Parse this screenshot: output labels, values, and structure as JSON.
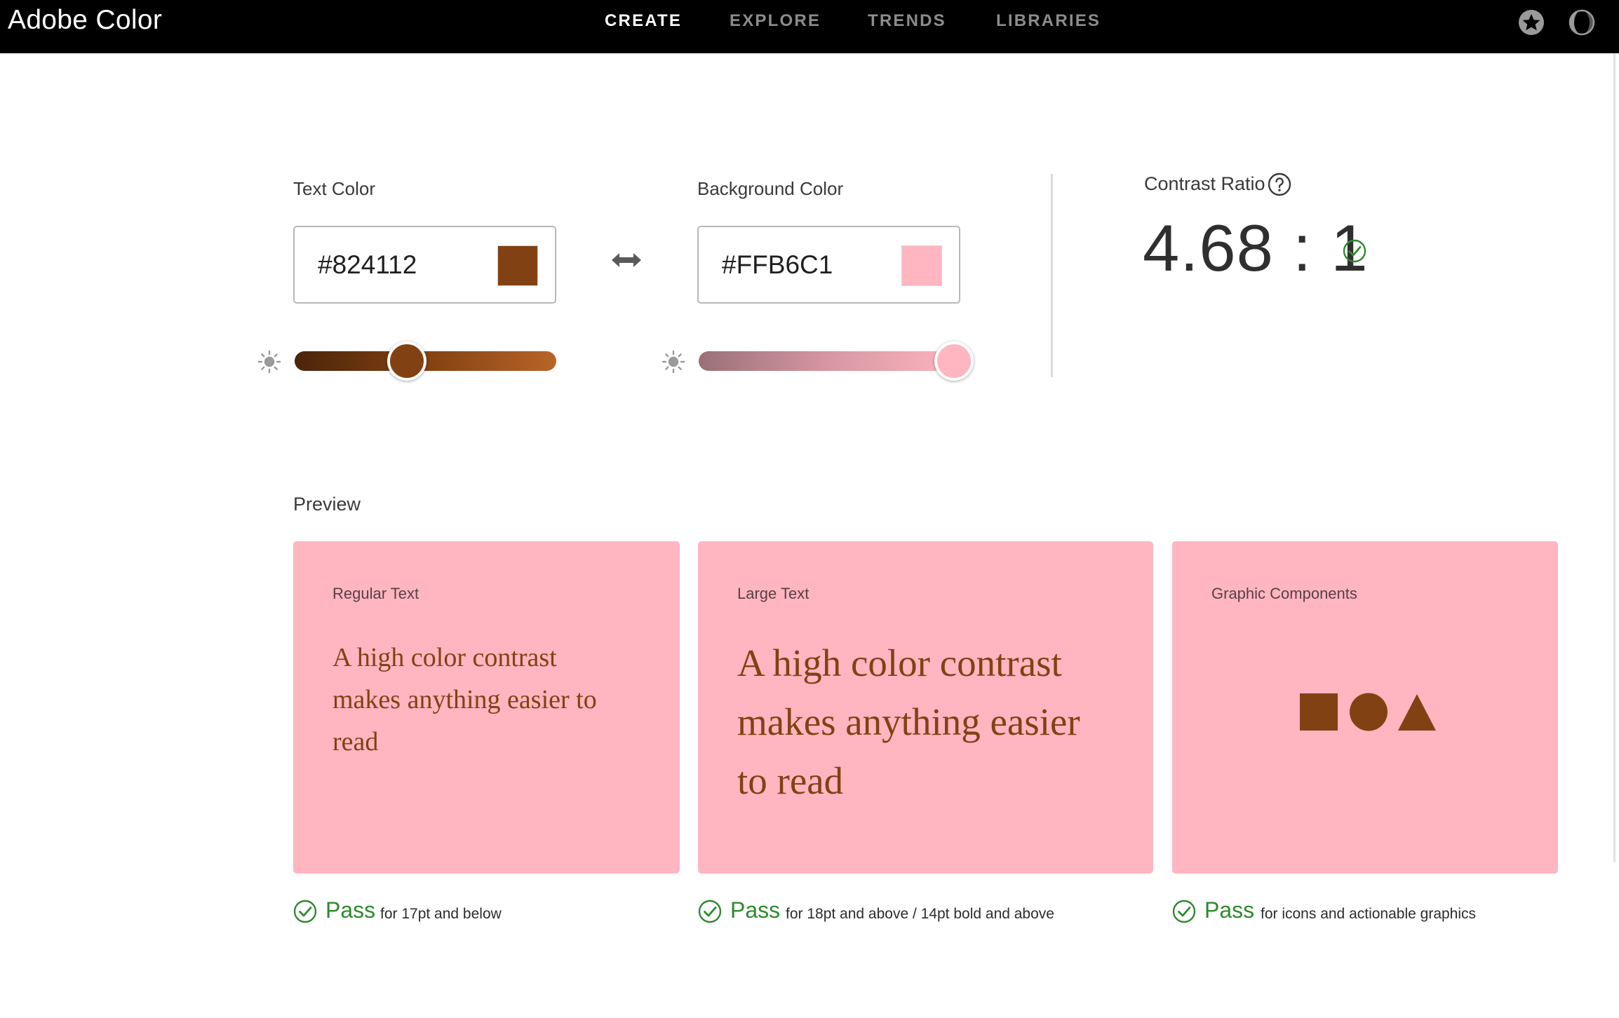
{
  "header": {
    "logo": "Adobe Color",
    "nav": [
      "CREATE",
      "EXPLORE",
      "TRENDS",
      "LIBRARIES"
    ],
    "active_nav": "CREATE",
    "icons": [
      "favorites-icon",
      "theme-toggle-icon"
    ]
  },
  "text_color": {
    "label": "Text Color",
    "hex": "#824112",
    "swatch": "#824112",
    "brightness_level": 0.43
  },
  "background_color": {
    "label": "Background Color",
    "hex": "#FFB6C1",
    "swatch": "#FFB6C1",
    "brightness_level": 1.0
  },
  "contrast": {
    "label": "Contrast Ratio",
    "value": "4.68 : 1",
    "status": "pass"
  },
  "preview": {
    "label": "Preview",
    "cards": [
      {
        "title": "Regular Text",
        "sample": "A high color contrast makes anything easier to read"
      },
      {
        "title": "Large Text",
        "sample": "A high color contrast makes anything easier to read"
      },
      {
        "title": "Graphic Components",
        "shapes": [
          "square",
          "circle",
          "triangle"
        ]
      }
    ],
    "results": [
      {
        "status": "Pass",
        "desc": "for 17pt and below"
      },
      {
        "status": "Pass",
        "desc": "for 18pt and above / 14pt bold and above"
      },
      {
        "status": "Pass",
        "desc": "for icons and actionable graphics"
      }
    ]
  },
  "colors": {
    "pass_green": "#2d8a2d",
    "text_color": "#824112",
    "background_color": "#FFB6C1"
  }
}
